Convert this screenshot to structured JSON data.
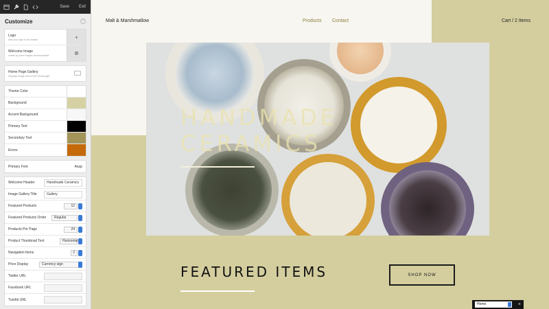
{
  "toolbar": {
    "icons": [
      "window-icon",
      "wrench-icon",
      "page-icon",
      "code-icon"
    ],
    "save": "Save",
    "exit": "Exit"
  },
  "customize": {
    "title": "Customize",
    "help": "?",
    "logo": {
      "label": "Logo",
      "sub": "Add your logo to the header",
      "action": "+"
    },
    "welcome_image": {
      "label": "Welcome Image",
      "sub": "create by more images recommended",
      "action": "⊗"
    },
    "gallery": {
      "label": "Home Page Gallery",
      "sub": "Displays image and on the Home page"
    },
    "colors": [
      {
        "label": "Theme Color",
        "swatch": "#ffffff"
      },
      {
        "label": "Background",
        "swatch": "#d6d1a4"
      },
      {
        "label": "Accent Background",
        "swatch": "#f7f7f7"
      },
      {
        "label": "Primary Text",
        "swatch": "#000000"
      },
      {
        "label": "Secondary Text",
        "swatch": "#a39559"
      },
      {
        "label": "Errors",
        "swatch": "#c46a0a"
      }
    ],
    "primary_font": {
      "label": "Primary Font",
      "value": "Asap"
    },
    "settings": {
      "welcome_header": {
        "label": "Welcome Header",
        "value": "Handmade Ceramics"
      },
      "gallery_title": {
        "label": "Image Gallery Title",
        "value": "Gallery"
      },
      "featured_products": {
        "label": "Featured Products",
        "value": "12"
      },
      "featured_order": {
        "label": "Featured Products Order",
        "value": "Regular"
      },
      "per_page": {
        "label": "Products Per Page",
        "value": "24"
      },
      "thumb_text": {
        "label": "Product Thumbnail Text",
        "value": "Horizontal"
      },
      "nav_items": {
        "label": "Navigation Items",
        "value": "2"
      },
      "price_display": {
        "label": "Price Display",
        "value": "Currency sign"
      },
      "twitter": {
        "label": "Twitter URL",
        "value": ""
      },
      "facebook": {
        "label": "Facebook URL",
        "value": ""
      },
      "tumblr": {
        "label": "Tumblr URL",
        "value": ""
      }
    }
  },
  "site": {
    "brand": "Malt & Marshmallow",
    "nav": [
      "Products",
      "Contact"
    ],
    "cart": "Cart / 2 Items",
    "hero_line1": "HANDMADE",
    "hero_line2": "CERAMICS",
    "featured": "FEATURED ITEMS",
    "shop_now": "SHOP NOW"
  },
  "page_switcher": {
    "value": "Home",
    "close": "×"
  },
  "colors": {
    "background": "#d4ce9f",
    "cream": "#f8f6f0",
    "accent": "#8a7f3f"
  }
}
